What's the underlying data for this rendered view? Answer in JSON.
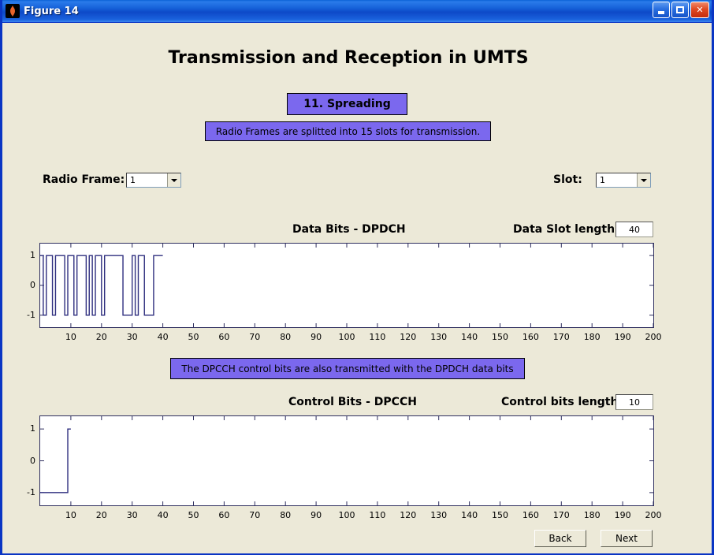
{
  "window": {
    "title": "Figure 14",
    "icon": "matlab-icon",
    "buttons": {
      "minimize": "minimize-icon",
      "maximize": "maximize-icon",
      "close": "close-icon"
    }
  },
  "figure": {
    "title": "Transmission and Reception in UMTS",
    "step_box": "11. Spreading",
    "info_1": "Radio Frames are splitted into 15 slots for transmission.",
    "info_2": "The DPCCH control bits are also transmitted with the DPDCH data bits"
  },
  "controls": {
    "radio_frame_label": "Radio Frame:",
    "radio_frame_value": "1",
    "slot_label": "Slot:",
    "slot_value": "1",
    "data_len_label": "Data Slot length",
    "data_len_value": "40",
    "ctrl_len_label": "Control bits length",
    "ctrl_len_value": "10",
    "back_button": "Back",
    "next_button": "Next"
  },
  "colors": {
    "figure_background": "#ece9d8",
    "accent_box": "#7b68ee",
    "trace": "#2f2f7f",
    "titlebar": "#1560d8",
    "axes_background": "#ffffff"
  },
  "chart_data": [
    {
      "type": "line",
      "name": "data-bits-plot",
      "title": "Data Bits - DPDCH",
      "xlabel": "",
      "ylabel": "",
      "xlim": [
        0,
        200
      ],
      "ylim": [
        -1.4,
        1.4
      ],
      "xticks": [
        10,
        20,
        30,
        40,
        50,
        60,
        70,
        80,
        90,
        100,
        110,
        120,
        130,
        140,
        150,
        160,
        170,
        180,
        190,
        200
      ],
      "yticks": [
        1,
        0,
        -1
      ],
      "ytick_labels": [
        "1",
        "0",
        "-1"
      ],
      "grid": false,
      "legend": false,
      "step_style": "stairs",
      "x": [
        0,
        1,
        2,
        3,
        4,
        5,
        6,
        7,
        8,
        9,
        10,
        11,
        12,
        13,
        14,
        15,
        16,
        17,
        18,
        19,
        20,
        21,
        22,
        23,
        24,
        25,
        26,
        27,
        28,
        29,
        30,
        31,
        32,
        33,
        34,
        35,
        36,
        37,
        38,
        39
      ],
      "values": [
        1,
        -1,
        1,
        1,
        -1,
        1,
        1,
        1,
        -1,
        1,
        1,
        -1,
        1,
        1,
        1,
        -1,
        1,
        -1,
        1,
        1,
        -1,
        1,
        1,
        1,
        1,
        1,
        1,
        -1,
        -1,
        -1,
        1,
        -1,
        1,
        1,
        -1,
        -1,
        -1,
        1,
        1,
        1
      ]
    },
    {
      "type": "line",
      "name": "control-bits-plot",
      "title": "Control Bits - DPCCH",
      "xlabel": "",
      "ylabel": "",
      "xlim": [
        0,
        200
      ],
      "ylim": [
        -1.4,
        1.4
      ],
      "xticks": [
        10,
        20,
        30,
        40,
        50,
        60,
        70,
        80,
        90,
        100,
        110,
        120,
        130,
        140,
        150,
        160,
        170,
        180,
        190,
        200
      ],
      "yticks": [
        1,
        0,
        -1
      ],
      "ytick_labels": [
        "1",
        "0",
        "-1"
      ],
      "grid": false,
      "legend": false,
      "step_style": "stairs",
      "x": [
        0,
        1,
        2,
        3,
        4,
        5,
        6,
        7,
        8,
        9
      ],
      "values": [
        -1,
        -1,
        -1,
        -1,
        -1,
        -1,
        -1,
        -1,
        -1,
        1
      ]
    }
  ]
}
